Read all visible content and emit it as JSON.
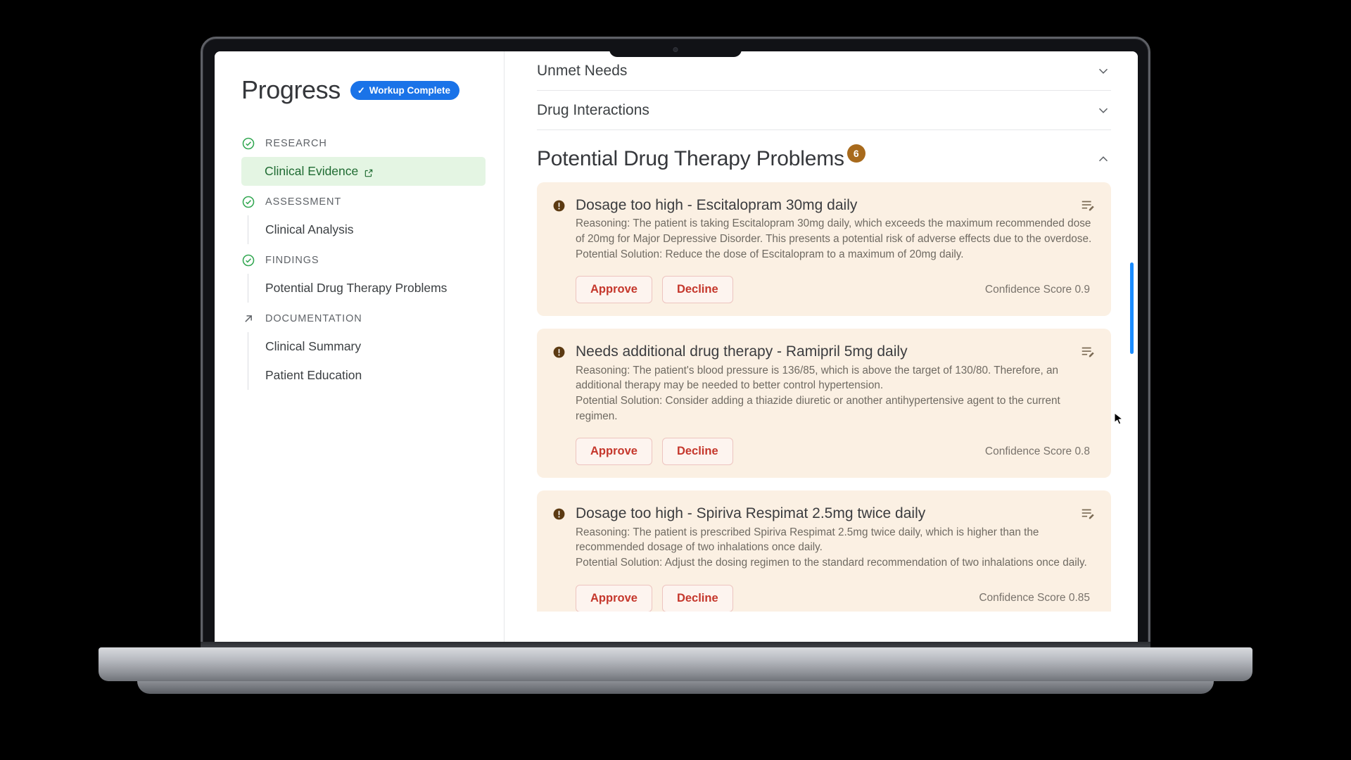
{
  "sidebar": {
    "title": "Progress",
    "badge": {
      "label": "Workup Complete",
      "icon": "check-icon",
      "color": "#1a73e8"
    },
    "sections": [
      {
        "label": "RESEARCH",
        "status_icon": "circle-check-icon",
        "items": [
          {
            "label": "Clinical Evidence",
            "active": true,
            "icon": "external-link-icon"
          }
        ]
      },
      {
        "label": "ASSESSMENT",
        "status_icon": "circle-check-icon",
        "items": [
          {
            "label": "Clinical Analysis",
            "active": false
          }
        ]
      },
      {
        "label": "FINDINGS",
        "status_icon": "circle-check-icon",
        "items": [
          {
            "label": "Potential Drug Therapy Problems",
            "active": false
          }
        ]
      },
      {
        "label": "DOCUMENTATION",
        "status_icon": "arrow-up-right-icon",
        "items": [
          {
            "label": "Clinical Summary",
            "active": false
          },
          {
            "label": "Patient Education",
            "active": false
          }
        ]
      }
    ]
  },
  "main": {
    "collapsed_sections": [
      {
        "label": "Unmet Needs",
        "chevron": "chevron-down-icon"
      },
      {
        "label": "Drug Interactions",
        "chevron": "chevron-down-icon"
      }
    ],
    "section": {
      "title": "Potential Drug Therapy Problems",
      "count": "6",
      "count_color": "#a86a1c",
      "chevron": "chevron-up-icon"
    },
    "actions": {
      "approve_label": "Approve",
      "decline_label": "Decline"
    },
    "cards": [
      {
        "title": "Dosage too high - Escitalopram 30mg daily",
        "reasoning": "Reasoning: The patient is taking Escitalopram 30mg daily, which exceeds the maximum recommended dose of 20mg for Major Depressive Disorder. This presents a potential risk of adverse effects due to the overdose.",
        "solution": "Potential Solution: Reduce the dose of Escitalopram to a maximum of 20mg daily.",
        "confidence": "Confidence Score 0.9",
        "alert_icon": "alert-circle-icon",
        "edit_icon": "edit-note-icon"
      },
      {
        "title": "Needs additional drug therapy - Ramipril 5mg daily",
        "reasoning": "Reasoning: The patient's blood pressure is 136/85, which is above the target of 130/80. Therefore, an additional therapy may be needed to better control hypertension.",
        "solution": "Potential Solution: Consider adding a thiazide diuretic or another antihypertensive agent to the current regimen.",
        "confidence": "Confidence Score 0.8",
        "alert_icon": "alert-circle-icon",
        "edit_icon": "edit-note-icon"
      },
      {
        "title": "Dosage too high - Spiriva Respimat 2.5mg twice daily",
        "reasoning": "Reasoning: The patient is prescribed Spiriva Respimat 2.5mg twice daily, which is higher than the recommended dosage of two inhalations once daily.",
        "solution": "Potential Solution: Adjust the dosing regimen to the standard recommendation of two inhalations once daily.",
        "confidence": "Confidence Score 0.85",
        "alert_icon": "alert-circle-icon",
        "edit_icon": "edit-note-icon"
      }
    ]
  }
}
